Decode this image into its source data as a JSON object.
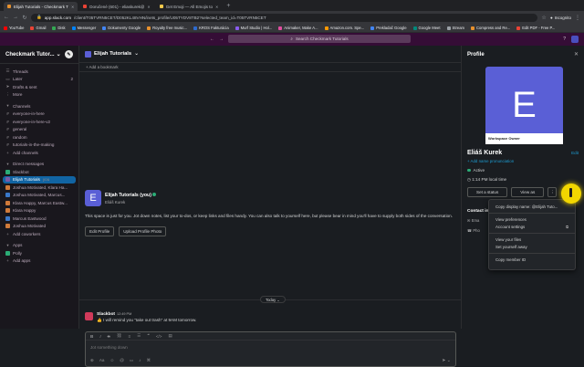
{
  "browser": {
    "tabs": [
      {
        "title": "Elijah Tutorials - Checkmark T",
        "active": true
      },
      {
        "title": "Doručené (601) - eliaskurek@",
        "active": false
      },
      {
        "title": "Get Emoji — All Emojis to",
        "active": false
      }
    ],
    "url_domain": "app.slack.com",
    "url_rest": "/client/T05TVRN5CET/D052KL48VHN/inets_profile/U05TYDV8TB2?selected_team_id=T05TVRN5CET",
    "profile_label": "Incognito",
    "bookmarks": [
      "YouTube",
      "Gmail",
      "Disk",
      "Messenger",
      "Dokumenty Google",
      "Royalty free music...",
      "KROS Fakturácia",
      "Murf Studio | Hol...",
      "Animaker, Make A...",
      "Amazon.com. Spe...",
      "Prekladač Google",
      "Google Meet",
      "Stream",
      "Compress and Re...",
      "Edit PDF - Free P..."
    ],
    "bookmark_colors": [
      "#ff0000",
      "#ea4335",
      "#34a853",
      "#0084ff",
      "#4285f4",
      "#e8912d",
      "#2d6bd0",
      "#8a5cf0",
      "#e24ea0",
      "#ff9900",
      "#4285f4",
      "#00897b",
      "#9aa0a6",
      "#e8912d",
      "#ea4335"
    ]
  },
  "topnav": {
    "search_placeholder": "Search Checkmark Tutorials"
  },
  "sidebar": {
    "workspace": "Checkmark Tutor...",
    "top_items": [
      "Threads",
      "Later",
      "Drafts & sent",
      "More"
    ],
    "later_count": "2",
    "channels_header": "Channels",
    "channels": [
      "everyone-in-here",
      "everyone-in-here-v2",
      "general",
      "random",
      "tutorials-in-the-making"
    ],
    "add_channels": "Add channels",
    "dm_header": "Direct messages",
    "dms": [
      {
        "name": "Slackbot",
        "suffix": ""
      },
      {
        "name": "Elijah Tutorials",
        "suffix": "you"
      },
      {
        "name": "Joshua Motivated, Klara Ha...",
        "suffix": ""
      },
      {
        "name": "Joshua Motivated, Marcus...",
        "suffix": ""
      },
      {
        "name": "Klara Happy, Marcus Eastw...",
        "suffix": ""
      },
      {
        "name": "Klara Happy",
        "suffix": ""
      },
      {
        "name": "Marcus Eastwood",
        "suffix": ""
      },
      {
        "name": "Joshua Motivated",
        "suffix": ""
      }
    ],
    "add_coworkers": "Add coworkers",
    "apps_header": "Apps",
    "apps": [
      "Polly"
    ],
    "add_apps": "Add apps"
  },
  "channel": {
    "title": "Elijah Tutorials",
    "add_bookmark": "+ Add a bookmark",
    "intro_name": "Elijah Tutorials (you)",
    "intro_sub": "Eliáš Kurek",
    "intro_text": "This space is just for you. Jot down notes, list your to-dos, or keep links and files handy. You can also talk to yourself here, but please bear in mind you'll have to supply both sides of the conversation.",
    "btn_edit": "Edit Profile",
    "btn_upload": "Upload Profile Photo",
    "today": "Today",
    "message": {
      "author": "Slackbot",
      "time": "12:49 PM",
      "text": "I will remind you “take out trash” at 9AM tomorrow."
    },
    "composer_placeholder": "Jot something down"
  },
  "profile": {
    "header": "Profile",
    "initial": "E",
    "owner_label": "Workspace Owner",
    "name": "Eliáš Kurek",
    "edit": "Edit",
    "pronunciation": "+ Add name pronunciation",
    "status": "Active",
    "local_time": "1:14 PM local time",
    "btn_status": "Set a status",
    "btn_view_as": "View as",
    "contact_header": "Contact in",
    "contact_1": "Ema",
    "contact_2": "Pho",
    "menu": [
      "Copy display name: @Elijah Tuto...",
      "View preferences",
      "Account settings",
      "View your files",
      "Set yourself away",
      "Copy member ID"
    ]
  }
}
